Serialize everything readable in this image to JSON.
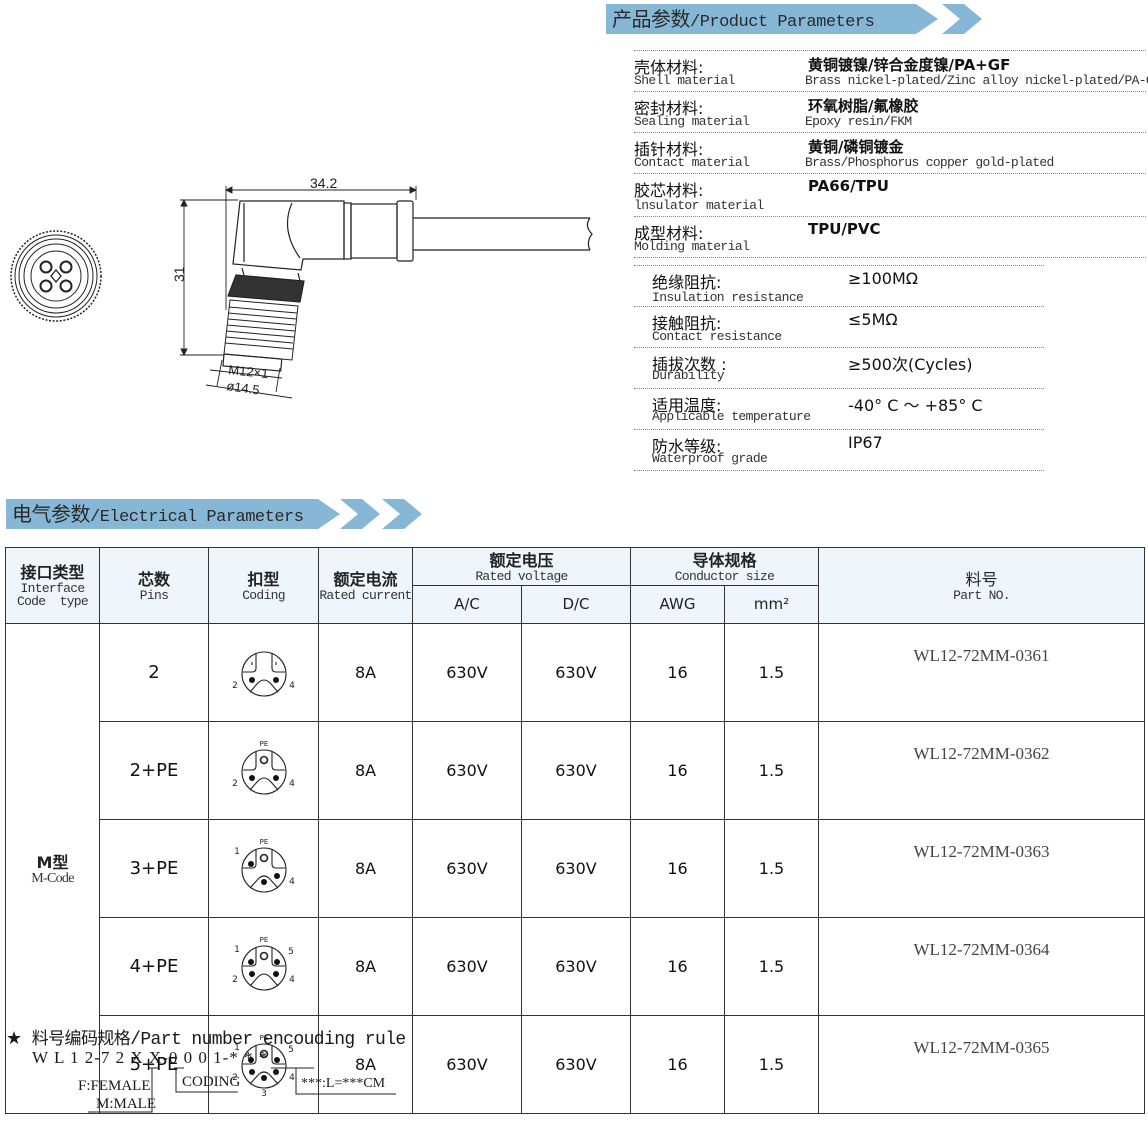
{
  "product_parameters": {
    "banner_cn": "产品参数",
    "banner_en": "/Product Parameters",
    "materials": [
      {
        "label_cn": "壳体材料:",
        "label_en": "Shell material",
        "value_cn": "黄铜镀镍/锌合金度镍/PA+GF",
        "value_en": "Brass nickel-plated/Zinc alloy nickel-plated/PA-GF"
      },
      {
        "label_cn": "密封材料:",
        "label_en": "Sealing material",
        "value_cn": "环氧树脂/氟橡胶",
        "value_en": "Epoxy resin/FKM"
      },
      {
        "label_cn": "插针材料:",
        "label_en": "Contact material",
        "value_cn": "黄铜/磷铜镀金",
        "value_en": "Brass/Phosphorus copper gold-plated"
      },
      {
        "label_cn": "胶芯材料:",
        "label_en": "lnsulator material",
        "value_cn": "PA66/TPU",
        "value_en": ""
      },
      {
        "label_cn": "成型材料:",
        "label_en": "Molding material",
        "value_cn": "TPU/PVC",
        "value_en": ""
      }
    ],
    "specs": [
      {
        "label_cn": "绝缘阻抗:",
        "label_en": "Insulation resistance",
        "value": "≥100MΩ"
      },
      {
        "label_cn": "接触阻抗:",
        "label_en": "Contact resistance",
        "value": "≤5MΩ"
      },
      {
        "label_cn": "插拔次数 :",
        "label_en": "Durability",
        "value": "≥500次(Cycles)"
      },
      {
        "label_cn": "适用温度:",
        "label_en": "Applicable temperature",
        "value": "-40° C ～ +85° C"
      },
      {
        "label_cn": "防水等级:",
        "label_en": "Waterproof grade",
        "value": "IP67"
      }
    ]
  },
  "drawing": {
    "dim_width": "34.2",
    "dim_height": "31",
    "thread": "M12×1",
    "diameter": "ø14.5"
  },
  "electrical_parameters": {
    "banner_cn": "电气参数",
    "banner_en": "/Electrical Parameters",
    "headers": {
      "interface_cn": "接口类型",
      "interface_en1": "Interface",
      "interface_en2": "Code  type",
      "pins_cn": "芯数",
      "pins_en": "Pins",
      "coding_cn": "扣型",
      "coding_en": "Coding",
      "current_cn": "额定电流",
      "current_en": "Rated current",
      "voltage_cn": "额定电压",
      "voltage_en": "Rated voltage",
      "ac": "A/C",
      "dc": "D/C",
      "conductor_cn": "导体规格",
      "conductor_en": "Conductor size",
      "awg": "AWG",
      "mm2": "mm²",
      "part_cn": "料号",
      "part_en": "Part NO."
    },
    "interface_type_cn": "M型",
    "interface_type_en": "M-Code",
    "rows": [
      {
        "pins": "2",
        "coding": "2-pin",
        "current": "8A",
        "ac": "630V",
        "dc": "630V",
        "awg": "16",
        "mm2": "1.5",
        "part_no": "WL12-72MM-0361"
      },
      {
        "pins": "2+PE",
        "coding": "2+PE",
        "current": "8A",
        "ac": "630V",
        "dc": "630V",
        "awg": "16",
        "mm2": "1.5",
        "part_no": "WL12-72MM-0362"
      },
      {
        "pins": "3+PE",
        "coding": "3+PE",
        "current": "8A",
        "ac": "630V",
        "dc": "630V",
        "awg": "16",
        "mm2": "1.5",
        "part_no": "WL12-72MM-0363"
      },
      {
        "pins": "4+PE",
        "coding": "4+PE",
        "current": "8A",
        "ac": "630V",
        "dc": "630V",
        "awg": "16",
        "mm2": "1.5",
        "part_no": "WL12-72MM-0364"
      },
      {
        "pins": "5+PE",
        "coding": "5+PE",
        "current": "8A",
        "ac": "630V",
        "dc": "630V",
        "awg": "16",
        "mm2": "1.5",
        "part_no": "WL12-72MM-0365"
      }
    ],
    "pin_labels": {
      "pe": "PE",
      "p1": "1",
      "p2": "2",
      "p3": "3",
      "p4": "4",
      "p5": "5"
    }
  },
  "encoding_rule": {
    "star": "★",
    "title_cn": "料号编码规格",
    "title_en": "/Part number encouding rule",
    "code": "W L 1 2-7 2 X X-0 0 0 1-* * *",
    "gender_female": "F:FEMALE",
    "gender_male": "M:MALE",
    "coding": "CODING",
    "length": "***:L=***CM"
  },
  "colors": {
    "banner": "#86b7d6",
    "header_bg": "#eef6fb"
  }
}
